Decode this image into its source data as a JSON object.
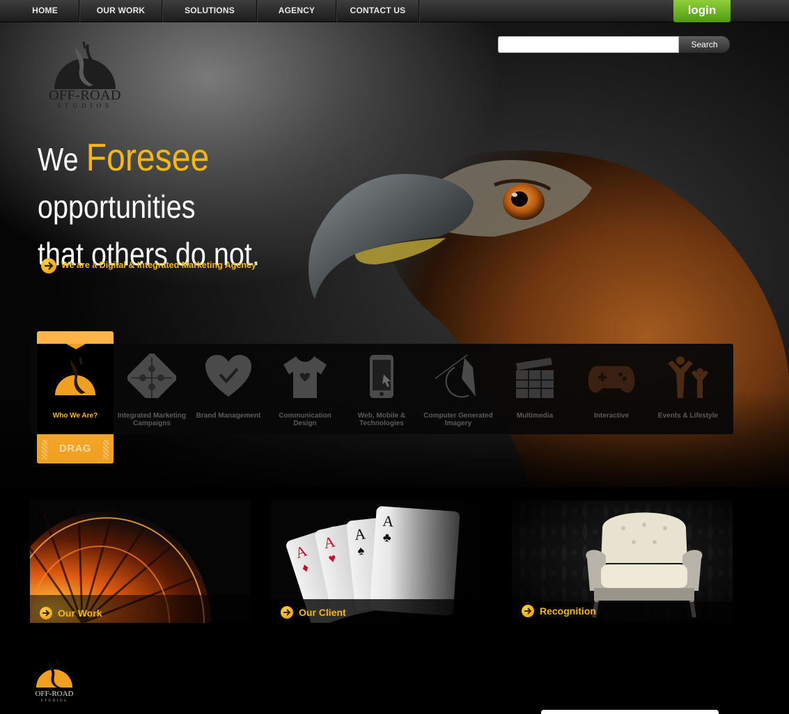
{
  "nav": {
    "items": [
      "HOME",
      "OUR WORK",
      "SOLUTIONS",
      "AGENCY",
      "CONTACT US"
    ],
    "login": "login"
  },
  "search": {
    "placeholder": "",
    "button": "Search"
  },
  "logo": {
    "name": "OFF-ROAD",
    "sub": "STUDIOS"
  },
  "hero": {
    "headline_pre": "We ",
    "headline_accent": "Foresee",
    "headline_post": " opportunities",
    "headline_line2": "that others do not.",
    "tagline": "We are a Digital & Integrated Marketing Agency"
  },
  "slider": {
    "drag_label": "DRAG",
    "services": [
      {
        "label": "Who We Are?",
        "icon": "logo-icon",
        "active": true
      },
      {
        "label": "Integrated Marketing Campaigns",
        "icon": "puzzle-icon"
      },
      {
        "label": "Brand Management",
        "icon": "heart-check-icon"
      },
      {
        "label": "Communication Design",
        "icon": "tshirt-icon"
      },
      {
        "label": "Web, Mobile & Technologies",
        "icon": "mobile-icon"
      },
      {
        "label": "Computer Generated Imagery",
        "icon": "pen-nib-icon"
      },
      {
        "label": "Multimedia",
        "icon": "clapperboard-icon"
      },
      {
        "label": "Interactive",
        "icon": "gamepad-icon"
      },
      {
        "label": "Events & Lifestyle",
        "icon": "people-icon"
      }
    ]
  },
  "promos": [
    {
      "label": "Our Work",
      "image": "ferris-wheel-image"
    },
    {
      "label": "Our Client",
      "image": "aces-cards-image"
    },
    {
      "label": "Recognition",
      "image": "armchair-image"
    }
  ],
  "footer": {
    "logo_name": "OFF-ROAD",
    "logo_sub": "STUDIOS"
  },
  "colors": {
    "accent": "#f6b800",
    "login_green": "#6ab520",
    "slider_orange": "#f0a020"
  }
}
